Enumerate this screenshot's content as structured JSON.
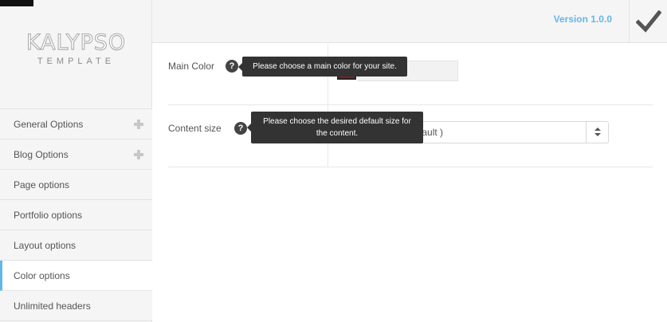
{
  "sidebar": {
    "logo": {
      "main": "KALYPSO",
      "sub": "TEMPLATE"
    },
    "items": [
      {
        "label": "General Options",
        "expandable": true,
        "active": false
      },
      {
        "label": "Blog Options",
        "expandable": true,
        "active": false
      },
      {
        "label": "Page options",
        "expandable": false,
        "active": false
      },
      {
        "label": "Portfolio options",
        "expandable": false,
        "active": false
      },
      {
        "label": "Layout options",
        "expandable": false,
        "active": false
      },
      {
        "label": "Color options",
        "expandable": false,
        "active": true
      },
      {
        "label": "Unlimited headers",
        "expandable": false,
        "active": false
      }
    ]
  },
  "header": {
    "version": "Version 1.0.0",
    "save_icon": "checkmark-icon"
  },
  "options": {
    "main_color": {
      "label": "Main Color",
      "help_glyph": "?",
      "tooltip": "Please choose a main color for your site.",
      "value": "#8b1a1a",
      "swatch_color": "#8b1a1a"
    },
    "content_size": {
      "label": "Content size",
      "help_glyph": "?",
      "tooltip": "Please choose the desired default size for the content.",
      "selected": "Default Style ( default )"
    }
  },
  "colors": {
    "accent": "#65b6e8",
    "tooltip_bg": "#333333",
    "sidebar_bg": "#f5f5f5"
  }
}
